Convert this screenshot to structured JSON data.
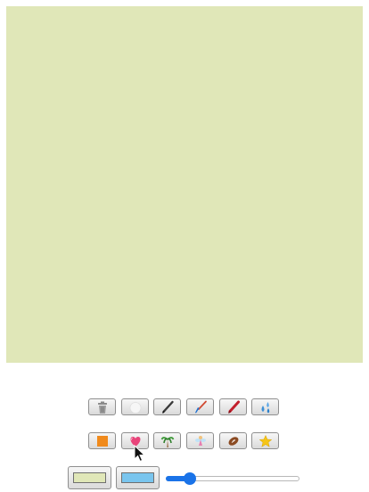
{
  "canvas": {
    "background_color": "#e0e7b8"
  },
  "toolbar_row1": [
    {
      "name": "trash-tool",
      "icon": "trash-icon"
    },
    {
      "name": "eraser-tool",
      "icon": "eraser-icon"
    },
    {
      "name": "pencil-tool",
      "icon": "pencil-icon"
    },
    {
      "name": "brush-tool",
      "icon": "paintbrush-icon"
    },
    {
      "name": "marker-tool",
      "icon": "marker-icon"
    },
    {
      "name": "spray-tool",
      "icon": "water-drops-icon"
    }
  ],
  "toolbar_row2": [
    {
      "name": "square-stamp-tool",
      "icon": "orange-square-icon"
    },
    {
      "name": "heart-stamp-tool",
      "icon": "heart-icon"
    },
    {
      "name": "palm-stamp-tool",
      "icon": "palm-tree-icon"
    },
    {
      "name": "fairy-stamp-tool",
      "icon": "fairy-icon"
    },
    {
      "name": "football-stamp-tool",
      "icon": "football-icon"
    },
    {
      "name": "star-stamp-tool",
      "icon": "star-icon"
    }
  ],
  "colors": {
    "background_swatch": "#e0e7b8",
    "foreground_swatch": "#79c5ee",
    "accent": "#1a73e8"
  },
  "brush_size": {
    "value": 0.18
  }
}
